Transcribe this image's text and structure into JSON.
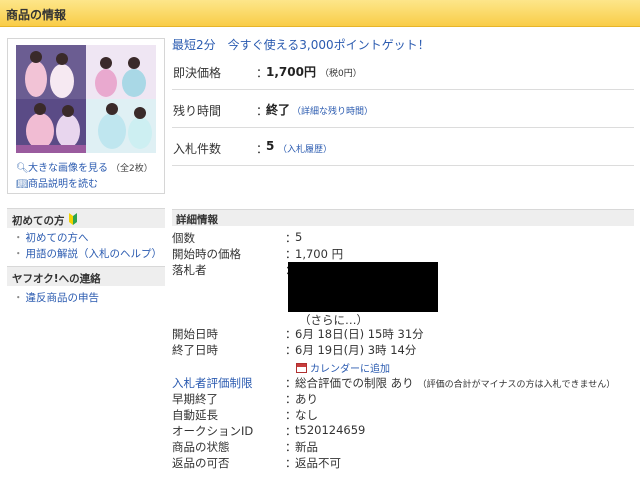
{
  "header": {
    "title": "商品の情報"
  },
  "photo": {
    "enlarge_label": "大きな画像を見る",
    "image_count": "（全2枚）",
    "description_label": "商品説明を読む"
  },
  "promo": {
    "text": "最短2分　今すぐ使える3,000ポイントゲット！"
  },
  "summary": {
    "buyout": {
      "label": "即決価格",
      "colon": "：",
      "value": "1,700円",
      "tax": "（税0円）"
    },
    "remaining": {
      "label": "残り時間",
      "colon": "：",
      "value": "終了",
      "detail": "（詳細な残り時間）"
    },
    "bids": {
      "label": "入札件数",
      "colon": "：",
      "value": "5",
      "history": "（入札履歴）"
    }
  },
  "sidebar": {
    "beginners_title": "初めての方",
    "beginners_links": [
      "初めての方へ",
      "用語の解説（入札のヘルプ）"
    ],
    "contact_title": "ヤフオク!への連絡",
    "contact_links": [
      "違反商品の申告"
    ],
    "bullet": "・"
  },
  "details": {
    "title": "詳細情報",
    "colon": "：",
    "rows": [
      {
        "label": "個数",
        "value": "5"
      },
      {
        "label": "開始時の価格",
        "value": "1,700 円"
      },
      {
        "label": "落札者",
        "value": ""
      },
      {
        "label": "開始日時",
        "value": "6月 18日(日) 15時 31分"
      },
      {
        "label": "終了日時",
        "value": "6月 19日(月) 3時 14分"
      },
      {
        "label": "入札者評価制限",
        "value": "総合評価での制限 あり",
        "note": "（評価の合計がマイナスの方は入札できません）"
      },
      {
        "label": "早期終了",
        "value": "あり"
      },
      {
        "label": "自動延長",
        "value": "なし"
      },
      {
        "label": "オークションID",
        "value": "t520124659"
      },
      {
        "label": "商品の状態",
        "value": "新品"
      },
      {
        "label": "返品の可否",
        "value": "返品不可"
      }
    ],
    "winner_more": "（さらに…）",
    "calendar_label": "カレンダーに追加"
  }
}
